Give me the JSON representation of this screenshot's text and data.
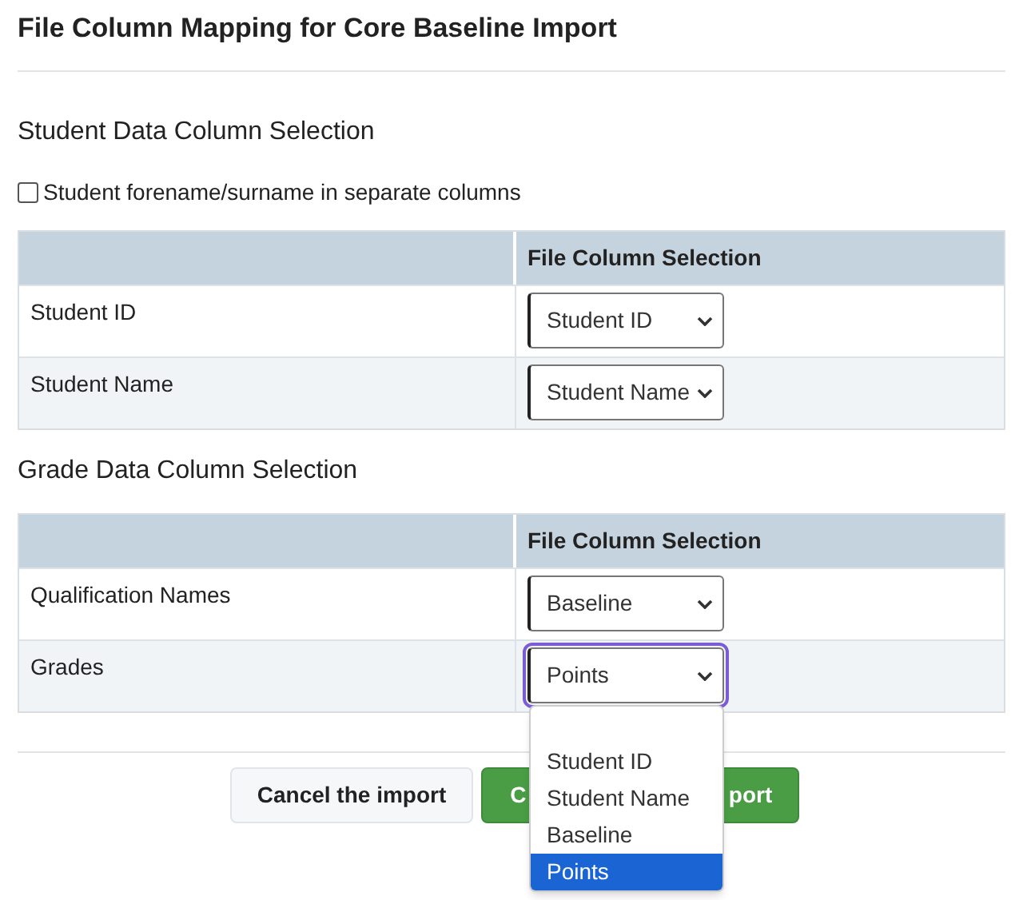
{
  "title": "File Column Mapping for Core Baseline Import",
  "sections": [
    {
      "heading": "Student Data Column Selection",
      "checkbox": {
        "label": "Student forename/surname in separate columns",
        "checked": false
      },
      "table": {
        "columns": [
          "File Column Selection"
        ],
        "rows": [
          {
            "label": "Student ID",
            "select": {
              "value": "Student ID",
              "expanded": false
            }
          },
          {
            "label": "Student Name",
            "select": {
              "value": "Student Name",
              "expanded": false
            }
          }
        ]
      }
    },
    {
      "heading": "Grade Data Column Selection",
      "table": {
        "columns": [
          "File Column Selection"
        ],
        "rows": [
          {
            "label": "Qualification Names",
            "select": {
              "value": "Baseline",
              "expanded": false
            }
          },
          {
            "label": "Grades",
            "select": {
              "value": "Points",
              "expanded": true,
              "options": [
                {
                  "kind": "blank",
                  "selected": false
                },
                {
                  "kind": "text",
                  "label": "Student ID",
                  "selected": false
                },
                {
                  "kind": "text",
                  "label": "Student Name",
                  "selected": false
                },
                {
                  "kind": "text",
                  "label": "Baseline",
                  "selected": false
                },
                {
                  "kind": "text",
                  "label": "Points",
                  "selected": true
                }
              ]
            }
          }
        ]
      }
    }
  ],
  "buttons": {
    "cancel": "Cancel the import",
    "confirm": {
      "visible_start": "C",
      "visible_end": "port"
    }
  }
}
